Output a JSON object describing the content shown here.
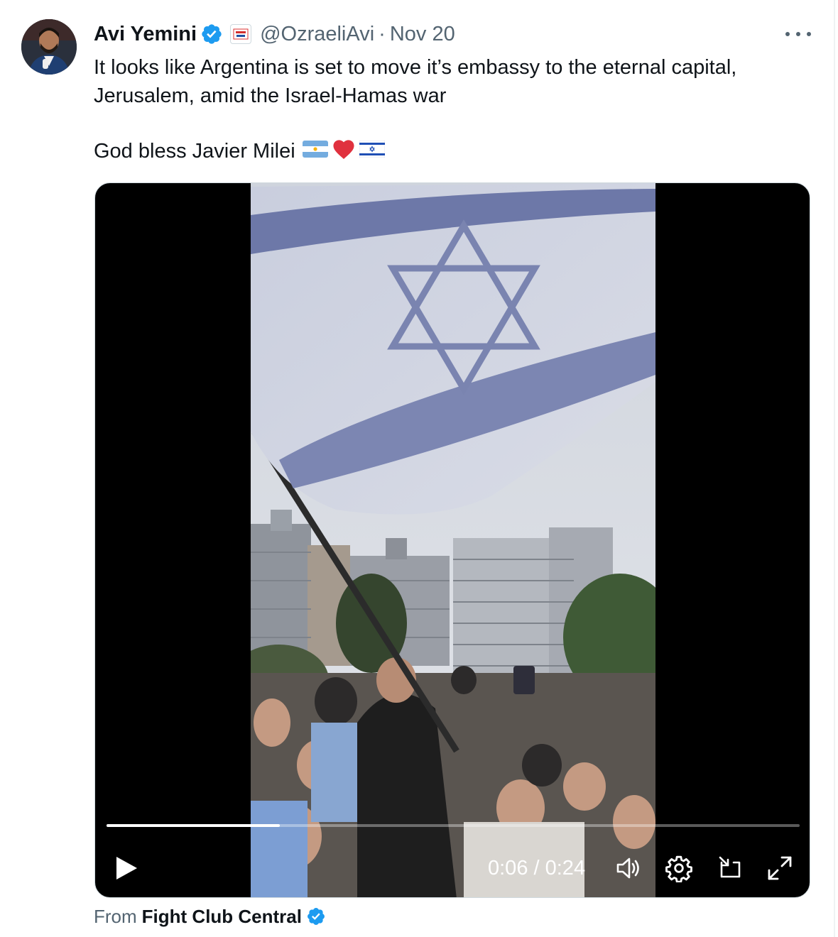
{
  "author": {
    "name": "Avi Yemini",
    "handle": "@OzraeliAvi",
    "separator": "·",
    "date": "Nov 20",
    "verified_icon": "verified-badge-icon",
    "affiliate_icon": "rebel-news-badge-icon"
  },
  "tweet": {
    "line1": "It looks like Argentina is set to move it’s embassy to the eternal capital,",
    "line2": "Jerusalem, amid the Israel-Hamas war",
    "line3": "God bless Javier Milei",
    "emojis": [
      "argentina-flag-icon",
      "red-heart-icon",
      "israel-flag-icon"
    ]
  },
  "video": {
    "current_time": "0:06",
    "time_separator": " / ",
    "duration": "0:24",
    "progress_fraction": 0.25,
    "controls": [
      "play-icon",
      "volume-icon",
      "settings-icon",
      "pip-icon",
      "fullscreen-icon"
    ]
  },
  "source": {
    "label": "From",
    "account": "Fight Club Central"
  },
  "colors": {
    "verified_blue": "#1d9bf0",
    "text_primary": "#0f1419",
    "text_secondary": "#536471",
    "heart_red": "#e0313e"
  }
}
